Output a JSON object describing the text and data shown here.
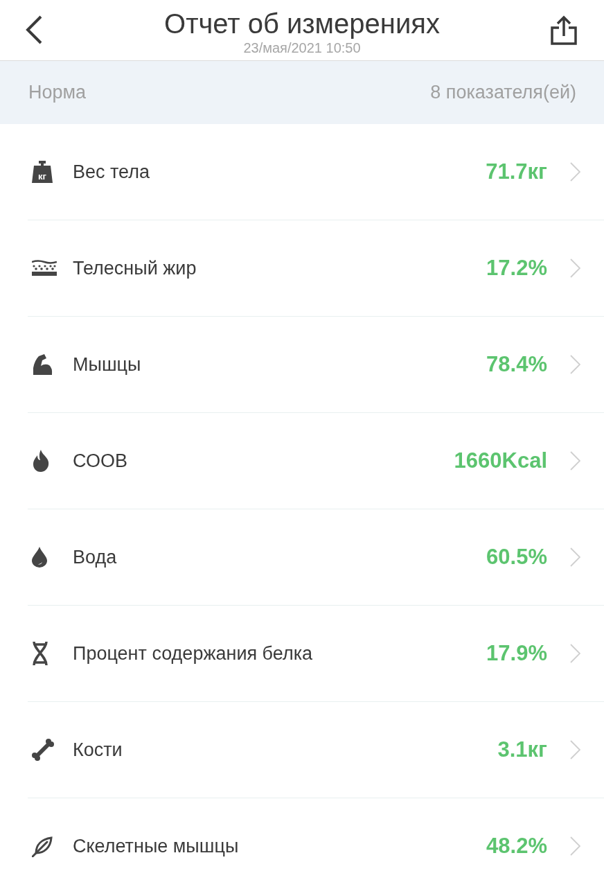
{
  "header": {
    "title": "Отчет об измерениях",
    "date": "23/мая/2021 10:50"
  },
  "summary": {
    "status": "Норма",
    "count": "8 показателя(ей)"
  },
  "items": [
    {
      "kind": "weight",
      "icon_text": "кг",
      "label": "Вес тела",
      "value": "71.7кг"
    },
    {
      "kind": "fat",
      "label": "Телесный жир",
      "value": "17.2%"
    },
    {
      "kind": "muscle",
      "label": "Мышцы",
      "value": "78.4%"
    },
    {
      "kind": "flame",
      "label": "СООВ",
      "value": "1660Kcal"
    },
    {
      "kind": "drop",
      "label": "Вода",
      "value": "60.5%"
    },
    {
      "kind": "dna",
      "label": "Процент содержания белка",
      "value": "17.9%"
    },
    {
      "kind": "bone",
      "label": "Кости",
      "value": "3.1кг"
    },
    {
      "kind": "fiber",
      "label": "Скелетные мышцы",
      "value": "48.2%"
    }
  ]
}
